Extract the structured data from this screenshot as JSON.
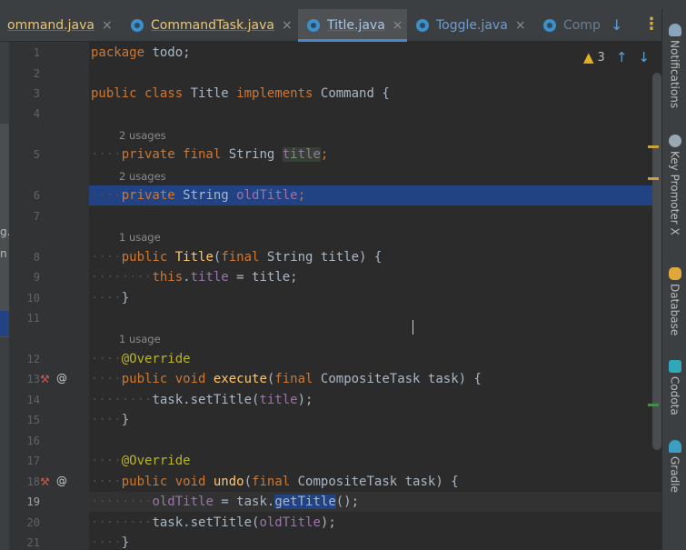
{
  "tabs": [
    {
      "label": "ommand.java",
      "state": "partial"
    },
    {
      "label": "CommandTask.java",
      "state": "normal"
    },
    {
      "label": "Title.java",
      "state": "active"
    },
    {
      "label": "Toggle.java",
      "state": "normal"
    },
    {
      "label": "Comp",
      "state": "partial"
    }
  ],
  "tab_close_glyph": "×",
  "tabbar_icons": {
    "down_arrow": "↓",
    "more": "⋮"
  },
  "left_panel_fragments": [
    "g.",
    "n"
  ],
  "inspections": {
    "warnings_count": "3",
    "warning_icon": "warning-triangle-icon"
  },
  "line_numbers": [
    "1",
    "2",
    "3",
    "4",
    "5",
    "6",
    "7",
    "8",
    "9",
    "10",
    "11",
    "12",
    "13",
    "14",
    "15",
    "16",
    "17",
    "18",
    "19",
    "20",
    "21"
  ],
  "usages": {
    "title_usages": "2 usages",
    "oldTitle_usages": "2 usages",
    "ctor_usages": "1 usage",
    "execute_usages": "1 usage"
  },
  "code": {
    "l1_kw": "package",
    "l1_rest": " todo;",
    "l3_kw1": "public class",
    "l3_name": " Title ",
    "l3_kw2": "implements",
    "l3_rest": " Command {",
    "l5_kw": "private final",
    "l5_type": " String ",
    "l5_field": "title",
    "l5_end": ";",
    "l6_kw": "private",
    "l6_type": " String ",
    "l6_field": "oldTitle",
    "l6_end": ";",
    "l8_kw": "public",
    "l8_name": "Title",
    "l8_open": "(",
    "l8_kw2": "final",
    "l8_rest": " String title) {",
    "l9_kw": "this",
    "l9_dot": ".",
    "l9_field": "title",
    "l9_rest": " = title;",
    "close_brace": "}",
    "l12_ann": "@Override",
    "l13_kw": "public void",
    "l13_name": "execute",
    "l13_open": "(",
    "l13_kw2": "final",
    "l13_rest": " CompositeTask task) {",
    "l14_pre": "task.setTitle(",
    "l14_field": "title",
    "l14_end": ");",
    "l17_ann": "@Override",
    "l18_kw": "public void",
    "l18_name": "undo",
    "l18_open": "(",
    "l18_kw2": "final",
    "l18_rest": " CompositeTask task) {",
    "l19_field": "oldTitle",
    "l19_mid": " = task.",
    "l19_call": "getTitle",
    "l19_end": "();",
    "l20_pre": "task.setTitle(",
    "l20_field": "oldTitle",
    "l20_end": ");"
  },
  "right_tools": [
    {
      "label": "Notifications",
      "icon": "bell-icon"
    },
    {
      "label": "Key Promoter X",
      "icon": "key-promoter-icon"
    },
    {
      "label": "Database",
      "icon": "database-icon"
    },
    {
      "label": "Codota",
      "icon": "codota-icon"
    },
    {
      "label": "Gradle",
      "icon": "gradle-icon"
    }
  ],
  "colors": {
    "keyword": "#cc7832",
    "field": "#9876aa",
    "method": "#ffc66d",
    "annotation": "#bbb529",
    "selection": "#214283"
  }
}
